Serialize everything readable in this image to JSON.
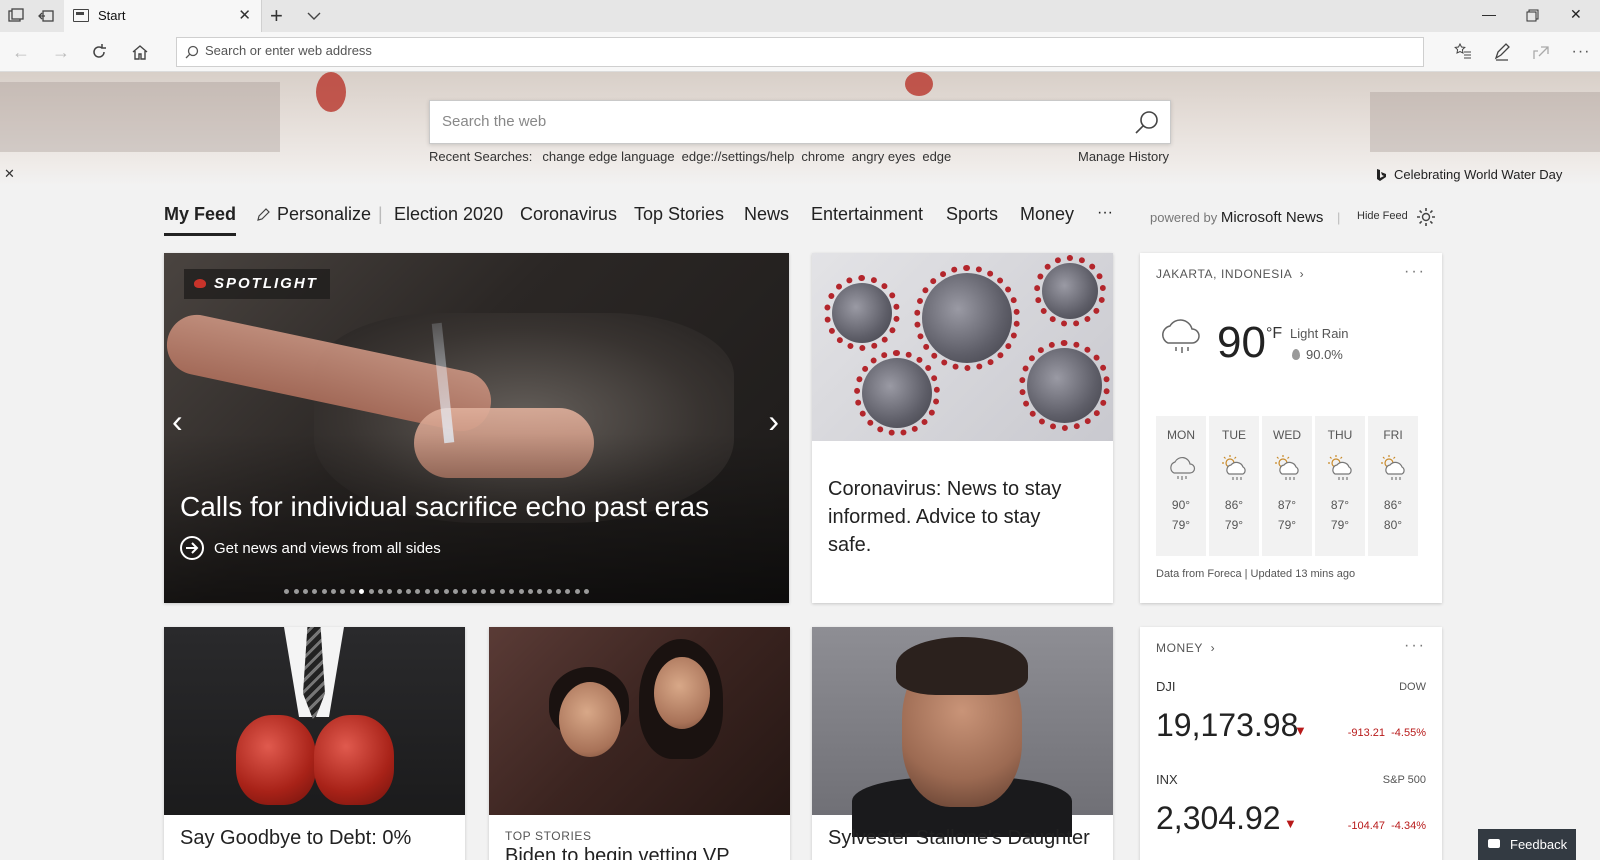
{
  "browser": {
    "tab_title": "Start",
    "address_placeholder": "Search or enter web address"
  },
  "hero": {
    "search_placeholder": "Search the web",
    "recent_label": "Recent Searches:",
    "recent_searches": [
      "change edge language",
      "edge://settings/help",
      "chrome",
      "angry eyes",
      "edge"
    ],
    "manage_history": "Manage History",
    "celebrating": "Celebrating World Water Day"
  },
  "feed_nav": {
    "items": [
      "My Feed",
      "Personalize",
      "Election 2020",
      "Coronavirus",
      "Top Stories",
      "News",
      "Entertainment",
      "Sports",
      "Money",
      "···"
    ],
    "powered_prefix": "powered by",
    "powered_brand": "Microsoft News",
    "hide_feed": "Hide Feed"
  },
  "spotlight": {
    "badge": "SPOTLIGHT",
    "title": "Calls for individual sacrifice echo past eras",
    "subtitle": "Get news and views from all sides",
    "slide_count": 33,
    "active_slide": 9
  },
  "covid_card": {
    "title": "Coronavirus: News to stay informed. Advice to stay safe."
  },
  "weather": {
    "location": "JAKARTA, INDONESIA",
    "temp": "90",
    "unit": "°F",
    "condition": "Light Rain",
    "humidity": "90.0%",
    "forecast": [
      {
        "day": "MON",
        "hi": "90°",
        "lo": "79°",
        "icon": "rain-cloud-icon"
      },
      {
        "day": "TUE",
        "hi": "86°",
        "lo": "79°",
        "icon": "sun-rain-icon"
      },
      {
        "day": "WED",
        "hi": "87°",
        "lo": "79°",
        "icon": "sun-rain-icon"
      },
      {
        "day": "THU",
        "hi": "87°",
        "lo": "79°",
        "icon": "sun-rain-icon"
      },
      {
        "day": "FRI",
        "hi": "86°",
        "lo": "80°",
        "icon": "sun-rain-icon"
      }
    ],
    "footer": "Data from Foreca | Updated 13 mins ago"
  },
  "bottom_cards": {
    "debt_title": "Say Goodbye to Debt: 0%",
    "politics_label": "TOP STORIES",
    "politics_title": "Biden to begin vetting VP",
    "stallone_title": "Sylvester Stallone's Daughter"
  },
  "money": {
    "header": "MONEY",
    "stocks": [
      {
        "symbol": "DJI",
        "name": "DOW",
        "value": "19,173.98",
        "change": "-913.21",
        "pct": "-4.55%"
      },
      {
        "symbol": "INX",
        "name": "S&P 500",
        "value": "2,304.92",
        "change": "-104.47",
        "pct": "-4.34%"
      }
    ]
  },
  "feedback": "Feedback",
  "colors": {
    "negative": "#b81a1a",
    "accent_red": "#c8332a"
  }
}
